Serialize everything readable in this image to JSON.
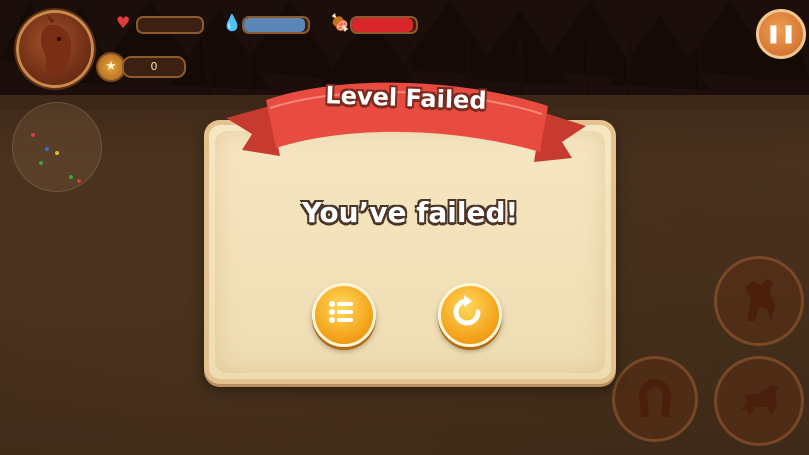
{
  "hud": {
    "avatar_icon": "horse-portrait-icon",
    "stats": [
      {
        "name": "health",
        "icon": "heart-icon",
        "color": "#e23b3b",
        "fill": 0.0
      },
      {
        "name": "water",
        "icon": "water-drop-icon",
        "color": "#5a86b8",
        "fill": 0.95
      },
      {
        "name": "food",
        "icon": "meat-icon",
        "color": "#d8262a",
        "fill": 0.95
      }
    ],
    "coins": {
      "icon": "coin-icon",
      "value": "0"
    },
    "minimap_icon": "minimap",
    "pause_icon": "pause-icon"
  },
  "dialog": {
    "title": "Level Failed",
    "message": "You’ve failed!",
    "buttons": [
      {
        "name": "level-menu-button",
        "icon": "list-icon",
        "color": "#f4a21b"
      },
      {
        "name": "restart-button",
        "icon": "restart-icon",
        "color": "#f4a21b"
      }
    ]
  },
  "controls": [
    {
      "name": "rear-up-button",
      "icon": "rearing-horse-icon"
    },
    {
      "name": "horseshoe-button",
      "icon": "horseshoe-icon"
    },
    {
      "name": "gallop-button",
      "icon": "galloping-horse-icon"
    }
  ],
  "colors": {
    "ribbon": "#e84b40",
    "panel": "#f3e2bb",
    "accent": "#f4a21b"
  }
}
